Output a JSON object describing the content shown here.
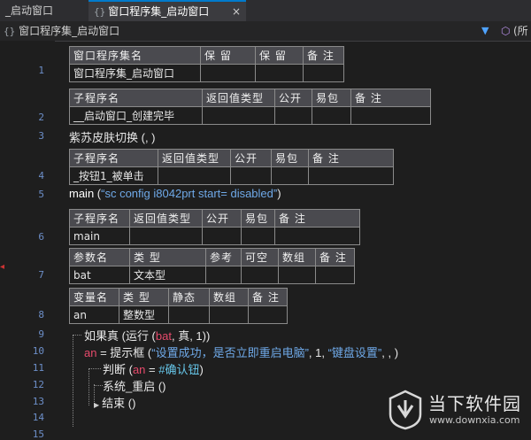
{
  "tabs": [
    {
      "label": "_启动窗口",
      "active": false
    },
    {
      "icon": "{}",
      "label": "窗口程序集_启动窗口",
      "active": true,
      "close": "×"
    }
  ],
  "breadcrumb": {
    "icon": "{}",
    "label": "窗口程序集_启动窗口",
    "right_label": "(所",
    "right_icon": "cube-icon"
  },
  "line_numbers": [
    "1",
    "2",
    "3",
    "4",
    "5",
    "6",
    "7",
    "8",
    "9",
    "10",
    "11",
    "12",
    "13",
    "14",
    "15"
  ],
  "tables": {
    "assembly": {
      "headers": [
        "窗口程序集名",
        "保 留",
        "保 留",
        "备 注"
      ],
      "values": [
        "窗口程序集_启动窗口",
        "",
        "",
        ""
      ]
    },
    "sub1": {
      "headers": [
        "子程序名",
        "返回值类型",
        "公开",
        "易包",
        "备 注"
      ],
      "values": [
        "__启动窗口_创建完毕",
        "",
        "",
        "",
        ""
      ]
    },
    "sub2": {
      "headers": [
        "子程序名",
        "返回值类型",
        "公开",
        "易包",
        "备 注"
      ],
      "values": [
        "_按钮1_被单击",
        "",
        "",
        "",
        ""
      ]
    },
    "sub3": {
      "headers": [
        "子程序名",
        "返回值类型",
        "公开",
        "易包",
        "备 注"
      ],
      "values": [
        "main",
        "",
        "",
        "",
        ""
      ]
    },
    "params": {
      "headers": [
        "参数名",
        "类 型",
        "参考",
        "可空",
        "数组",
        "备 注"
      ],
      "values": [
        "bat",
        "文本型",
        "",
        "",
        "",
        ""
      ]
    },
    "vars": {
      "headers": [
        "变量名",
        "类 型",
        "静态",
        "数组",
        "备 注"
      ],
      "values": [
        "an",
        "整数型",
        "",
        "",
        ""
      ]
    }
  },
  "code": {
    "line3": "紫苏皮肤切换 (, )",
    "line5_func": "main",
    "line5_open": " (",
    "line5_str": "“sc config i8042prt start= disabled”",
    "line5_close": ")",
    "line9_a": "如果真 (运行 (",
    "line9_b": "bat",
    "line9_c": ", 真, 1))",
    "line10_a": "an",
    "line10_b": " = 提示框 (",
    "line10_str1": "“设置成功，是否立即重启电脑”",
    "line10_c": ", 1, ",
    "line10_str2": "“键盘设置”",
    "line10_d": ", , )",
    "line11_a": "判断 (",
    "line11_b": "an",
    "line11_c": " = ",
    "line11_d": "#确认钮",
    "line11_e": ")",
    "line12": "系统_重启 ()",
    "line13": "结束 ()"
  },
  "watermark": {
    "title": "当下软件园",
    "url": "www.downxia.com"
  }
}
